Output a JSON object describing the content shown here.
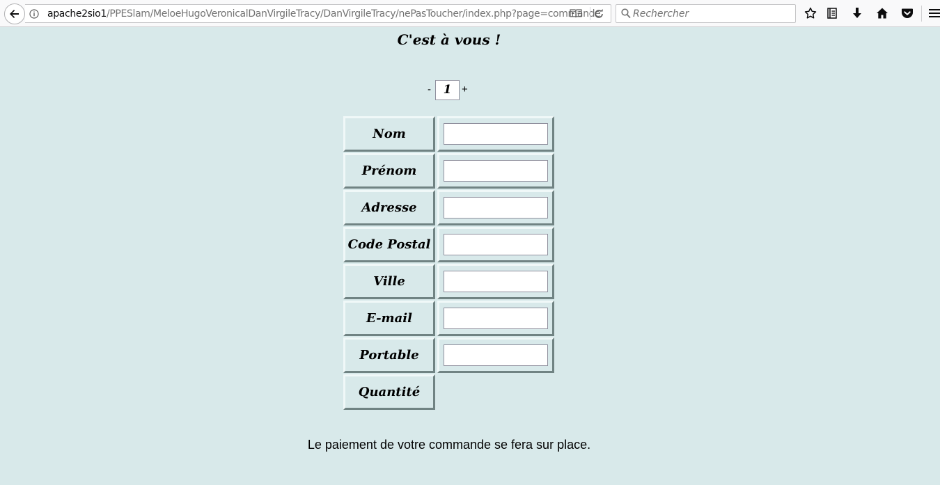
{
  "browser": {
    "url_host": "apache2sio1",
    "url_path": "/PPESlam/MeloeHugoVeronicalDanVirgileTracy/DanVirgileTracy/nePasToucher/index.php?page=commande",
    "search_placeholder": "Rechercher",
    "icons": [
      "back-arrow-icon",
      "info-icon",
      "reader-view-icon",
      "reload-icon",
      "search-icon",
      "bookmark-star-icon",
      "library-icon",
      "download-icon",
      "home-icon",
      "pocket-icon",
      "hamburger-menu-icon"
    ]
  },
  "page": {
    "title": "C'est à vous !",
    "quantity": {
      "minus_label": "-",
      "value": "1",
      "plus_label": "+"
    },
    "form": {
      "fields": [
        {
          "label": "Nom",
          "value": ""
        },
        {
          "label": "Prénom",
          "value": ""
        },
        {
          "label": "Adresse",
          "value": ""
        },
        {
          "label": "Code Postal",
          "value": ""
        },
        {
          "label": "Ville",
          "value": ""
        },
        {
          "label": "E-mail",
          "value": ""
        },
        {
          "label": "Portable",
          "value": ""
        }
      ],
      "quantity_label": "Quantité"
    },
    "payment_note": "Le paiement de votre commande se fera sur place."
  },
  "colors": {
    "page_background": "#d8e9ea",
    "cell_border_light": "#f0f8f8",
    "cell_border_dark": "#708383",
    "toolbar_background": "#f9f9fa"
  }
}
